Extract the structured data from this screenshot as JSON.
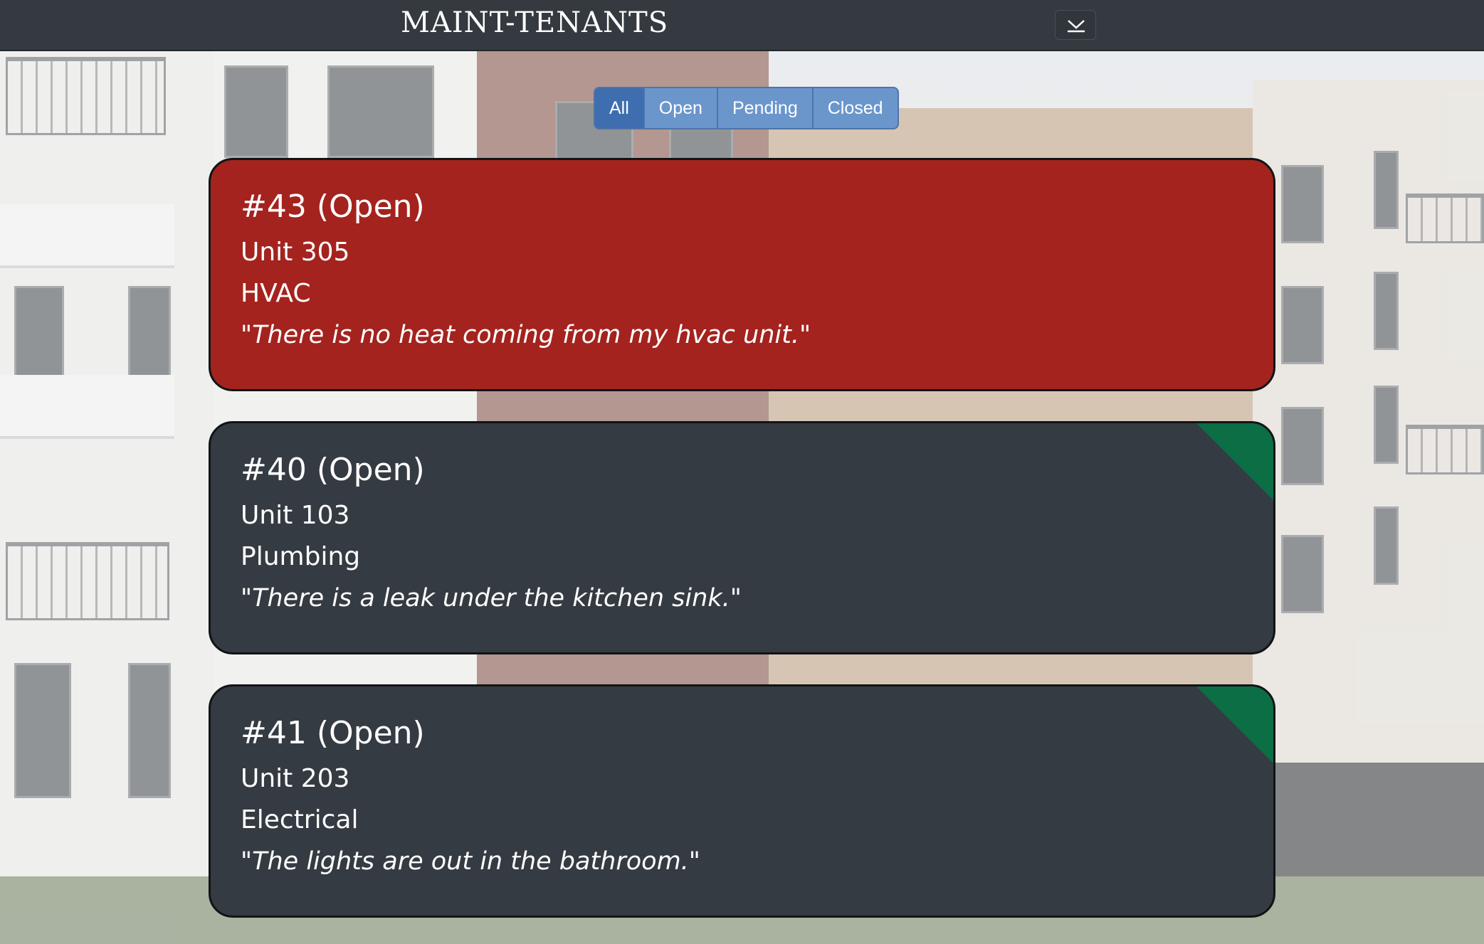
{
  "app": {
    "title": "MAINT-TENANTS"
  },
  "navbar": {
    "toggle_icon": "chevron-down-icon"
  },
  "filters": [
    {
      "label": "All",
      "active": true
    },
    {
      "label": "Open",
      "active": false
    },
    {
      "label": "Pending",
      "active": false
    },
    {
      "label": "Closed",
      "active": false
    }
  ],
  "colors": {
    "navbar": "#343a40",
    "urgent_card": "#a4231e",
    "normal_card": "#353b42",
    "corner_flag": "#0b6e45",
    "filter_active": "#3e6eb0",
    "filter": "#6b96cc"
  },
  "tickets": [
    {
      "title": "#43 (Open)",
      "unit": "Unit 305",
      "category": "HVAC",
      "description": "\"There is no heat coming from my hvac unit.\"",
      "style": "urgent"
    },
    {
      "title": "#40 (Open)",
      "unit": "Unit 103",
      "category": "Plumbing",
      "description": "\"There is a leak under the kitchen sink.\"",
      "style": "normal"
    },
    {
      "title": "#41 (Open)",
      "unit": "Unit 203",
      "category": "Electrical",
      "description": "\"The lights are out in the bathroom.\"",
      "style": "normal"
    }
  ]
}
